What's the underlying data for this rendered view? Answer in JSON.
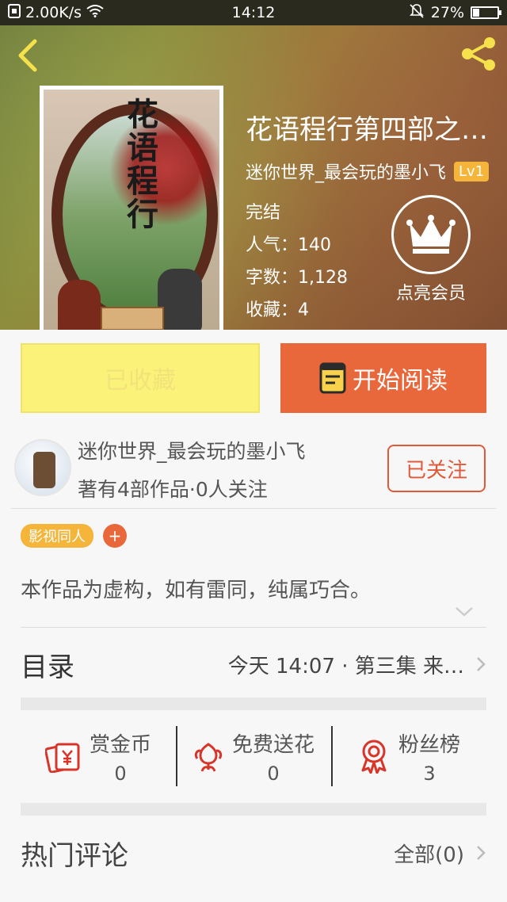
{
  "status_bar": {
    "network_speed": "2.00K/s",
    "time": "14:12",
    "battery_percent": "27%",
    "battery_level": 0.27
  },
  "book": {
    "cover_title": "花语程行",
    "title": "花语程行第四部之…",
    "author": "迷你世界_最会玩的墨小飞",
    "author_level": "Lv1",
    "status": "完结",
    "popularity": "人气：140",
    "word_count": "字数：1,128",
    "favorites": "收藏：4",
    "vip_label": "点亮会员"
  },
  "actions": {
    "favorited_label": "已收藏",
    "read_label": "开始阅读"
  },
  "author_card": {
    "name": "迷你世界_最会玩的墨小飞",
    "stats": "著有4部作品·0人关注",
    "follow_label": "已关注"
  },
  "tags": {
    "items": [
      "影视同人"
    ],
    "add_label": "+"
  },
  "description": "本作品为虚构，如有雷同，纯属巧合。",
  "toc": {
    "title": "目录",
    "latest": "今天 14:07 · 第三集 来…"
  },
  "stats": [
    {
      "label": "赏金币",
      "value": "0",
      "icon": "reward-coin-icon"
    },
    {
      "label": "免费送花",
      "value": "0",
      "icon": "flower-icon"
    },
    {
      "label": "粉丝榜",
      "value": "3",
      "icon": "medal-icon"
    }
  ],
  "comments": {
    "title": "热门评论",
    "all_label": "全部(0)"
  },
  "colors": {
    "accent_orange": "#e8673b",
    "accent_yellow": "#fbf27a",
    "badge_gold": "#f5b53b",
    "follow_red": "#e05a3a"
  }
}
